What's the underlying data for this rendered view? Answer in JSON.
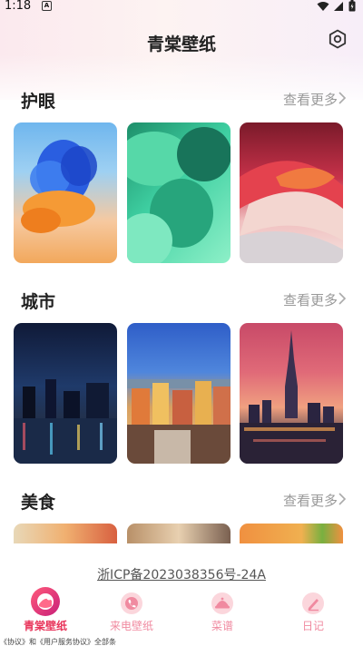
{
  "status": {
    "time": "1:18",
    "notif_icon": "a-notification-icon"
  },
  "header": {
    "title": "青棠壁纸",
    "settings_icon": "settings-icon"
  },
  "sections": [
    {
      "title": "护眼",
      "more": "查看更多"
    },
    {
      "title": "城市",
      "more": "查看更多"
    },
    {
      "title": "美食",
      "more": "查看更多"
    }
  ],
  "footer": {
    "icp": "浙ICP备2023038356号-24A"
  },
  "tabs": [
    {
      "label": "青棠壁纸",
      "active": true,
      "icon": "wallpaper-icon"
    },
    {
      "label": "来电壁纸",
      "active": false,
      "icon": "incoming-call-icon"
    },
    {
      "label": "菜谱",
      "active": false,
      "icon": "recipe-icon"
    },
    {
      "label": "日记",
      "active": false,
      "icon": "diary-icon"
    }
  ],
  "colors": {
    "active_tab": "#e8345a",
    "inactive_tab": "#f0a0b0",
    "accent": "#e8345a"
  },
  "bottom_strip": {
    "text": "《协议》和《用户服务协议》全部条"
  }
}
